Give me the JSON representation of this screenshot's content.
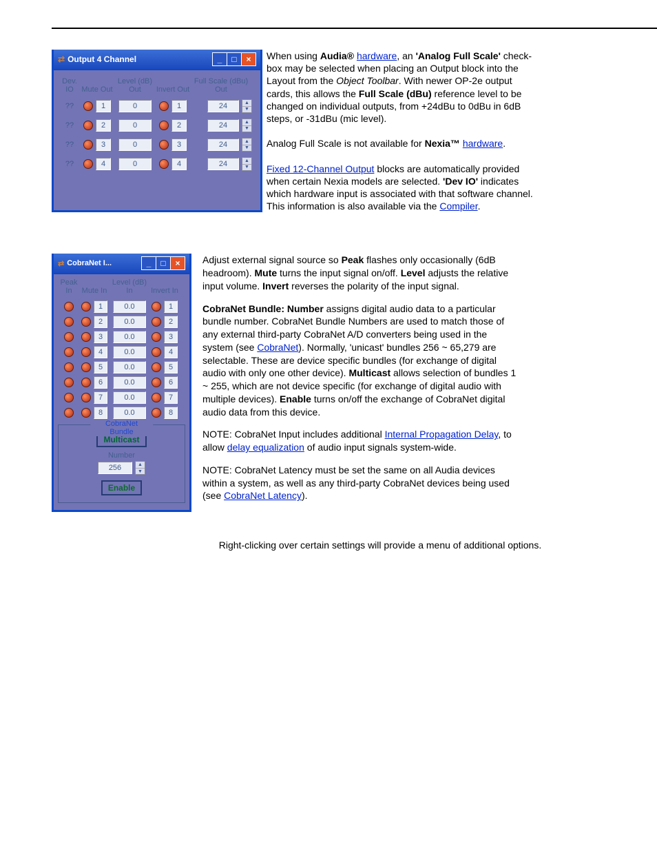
{
  "output_window": {
    "title": "Output 4 Channel",
    "headers": {
      "dev": "Dev.\nIO",
      "mute": "Mute\nOut",
      "level": "Level (dB)\nOut",
      "invert": "Invert\nOut",
      "fs": "Full Scale (dBu)\nOut"
    },
    "rows": [
      {
        "dev": "??",
        "ch": "1",
        "level": "0",
        "inv": "1",
        "fs": "24"
      },
      {
        "dev": "??",
        "ch": "2",
        "level": "0",
        "inv": "2",
        "fs": "24"
      },
      {
        "dev": "??",
        "ch": "3",
        "level": "0",
        "inv": "3",
        "fs": "24"
      },
      {
        "dev": "??",
        "ch": "4",
        "level": "0",
        "inv": "4",
        "fs": "24"
      }
    ]
  },
  "top_text": {
    "when_using": "When using ",
    "audiareg": "Audia®",
    "hardware": " ",
    "hardware_link": "hardware",
    "an": ", an ",
    "analogfs": "'Analog Full Scale'",
    "checkbox": " check-box may be selected when placing an Output block into the Layout from the ",
    "objtoolbar_em": "Object Toolbar",
    "rest1": ". With newer OP-2e output cards, this allows the ",
    "fs_em": "Full Scale (dBu)",
    "rest2": " reference level to be changed on individual outputs, from +24dBu to 0dBu in 6dB steps, or -31dBu (mic level).",
    "na_for": "Analog Full Scale is not available for ",
    "nexia": "Nexia™ ",
    "period1": ".",
    "fixed_link": "Fixed 12-Channel Output",
    "fixed_txt": " blocks are automatically provided when certain Nexia models are selected. ",
    "devio_lbl": "'Dev IO'",
    "devio_txt": " indicates which hardware input is associated with that software channel. This information is also available via the ",
    "compiler_link": "Compiler",
    "period2": "."
  },
  "cobranet_window": {
    "title": "CobraNet I...",
    "headers": {
      "peak": "Peak\nIn",
      "mute": "Mute\nIn",
      "level": "Level (dB)\nIn",
      "invert": "Invert\nIn"
    },
    "rows": [
      {
        "ch": "1",
        "level": "0.0"
      },
      {
        "ch": "2",
        "level": "0.0"
      },
      {
        "ch": "3",
        "level": "0.0"
      },
      {
        "ch": "4",
        "level": "0.0"
      },
      {
        "ch": "5",
        "level": "0.0"
      },
      {
        "ch": "6",
        "level": "0.0"
      },
      {
        "ch": "7",
        "level": "0.0"
      },
      {
        "ch": "8",
        "level": "0.0"
      }
    ],
    "frame_legend": "CobraNet Bundle",
    "multicast": "Multicast",
    "number_lbl": "Number",
    "number_val": "256",
    "enable": "Enable"
  },
  "cnet_text": {
    "p1_a": "Adjust external signal source so ",
    "peak": "Peak",
    "p1_b": " flashes only occasionally (6dB headroom). ",
    "mute": "Mute",
    "p1_c": " turns the input signal on/off. ",
    "level": "Level",
    "p1_d": " adjusts the relative input volume. ",
    "invert": "Invert",
    "p1_e": " reverses the polarity of the input signal.",
    "p2_a": "CobraNet Bundle: ",
    "number": "Number",
    "p2_b": " assigns digital audio data to a particular bundle number. CobraNet Bundle Numbers are used to match those of any external third-party CobraNet A/D converters being used in the system (see ",
    "cobranet_link": "CobraNet",
    "p2_c": "). Normally, 'unicast' bundles 256 ~ 65,279 are selectable. These are device specific bundles (for exchange of digital audio with only one other device). ",
    "multicast": "Multicast",
    "p2_d": " allows selection of bundles 1 ~ 255, which are not device specific (for exchange of digital audio with multiple devices). ",
    "enable": "Enable",
    "p2_e": " turns on/off the exchange of CobraNet digital audio data from this device.",
    "p3_a": "NOTE: CobraNet Input includes additional ",
    "int_prop": "Internal Propagation Delay",
    "p3_b": ", to allow ",
    "delay_eq": "delay equalization",
    "p3_c": " of audio input signals system-wide.",
    "p4_a": "NOTE: CobraNet Latency must be set the same on all Audia devices within a system, as well as any third-party CobraNet devices being used (see ",
    "lat_link": "CobraNet Latency",
    "p4_b": ")."
  },
  "rc_text": "Right-clicking over certain settings will provide a menu of additional options."
}
